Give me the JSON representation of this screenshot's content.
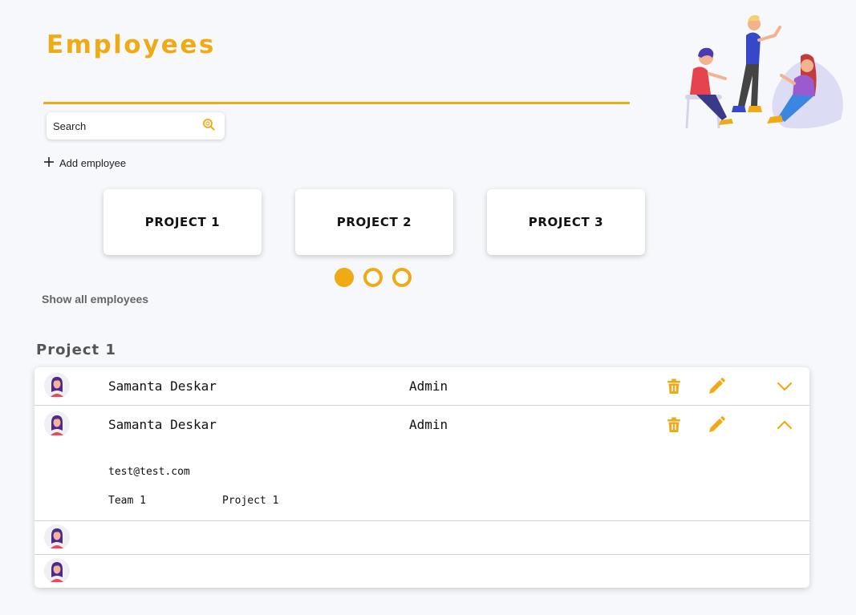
{
  "page": {
    "title": "Employees"
  },
  "search": {
    "placeholder": "Search"
  },
  "actions": {
    "add_employee": "Add employee",
    "show_all": "Show all employees"
  },
  "projects": [
    "PROJECT 1",
    "PROJECT 2",
    "PROJECT 3"
  ],
  "carousel": {
    "pages": 3,
    "active": 1
  },
  "section": {
    "title": "Project 1"
  },
  "employees": [
    {
      "name": "Samanta Deskar",
      "role": "Admin",
      "expanded": false
    },
    {
      "name": "Samanta Deskar",
      "role": "Admin",
      "expanded": true,
      "email": "test@test.com",
      "team": "Team 1",
      "project": "Project 1"
    },
    {
      "name": "",
      "role": "",
      "expanded": false
    },
    {
      "name": "",
      "role": "",
      "expanded": false
    }
  ],
  "icons": {
    "search": "search-icon",
    "add": "plus-icon",
    "delete": "trash-icon",
    "edit": "pencil-icon",
    "expand": "chevron-down-icon",
    "collapse": "chevron-up-icon",
    "avatar": "user-avatar-icon"
  },
  "colors": {
    "accent": "#f0aa15",
    "background": "#f6f8fb",
    "text": "#111111",
    "muted": "#666666"
  }
}
